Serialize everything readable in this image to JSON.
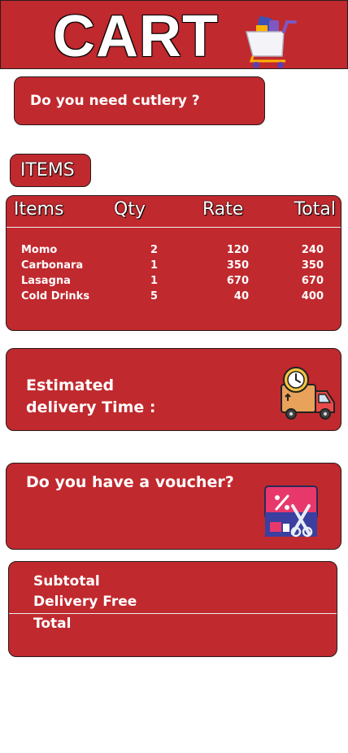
{
  "header": {
    "title": "CART"
  },
  "cutlery": {
    "label": "Do you need cutlery ?"
  },
  "items_tag": {
    "label": "ITEMS"
  },
  "table": {
    "headers": {
      "items": "Items",
      "qty": "Qty",
      "rate": "Rate",
      "total": "Total"
    },
    "rows": [
      {
        "name": "Momo",
        "qty": "2",
        "rate": "120",
        "total": "240"
      },
      {
        "name": "Carbonara",
        "qty": "1",
        "rate": "350",
        "total": "350"
      },
      {
        "name": "Lasagna",
        "qty": "1",
        "rate": "670",
        "total": "670"
      },
      {
        "name": "Cold Drinks",
        "qty": "5",
        "rate": "40",
        "total": "400"
      }
    ]
  },
  "delivery": {
    "label": "Estimated delivery Time :",
    "icon": "delivery-truck-icon"
  },
  "voucher": {
    "label": "Do you have a voucher?",
    "icon": "voucher-ticket-icon"
  },
  "summary": {
    "subtotal_label": "Subtotal",
    "delivery_label": "Delivery Free",
    "total_label": "Total"
  },
  "colors": {
    "accent": "#c0292e",
    "background": "#ffffff",
    "text": "#ffffff"
  }
}
